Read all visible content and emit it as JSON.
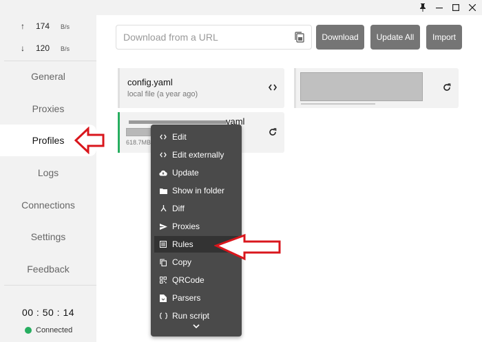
{
  "titlebar": {
    "pin_icon": "pin-icon",
    "minimize_icon": "minimize-icon",
    "maximize_icon": "maximize-icon",
    "close_icon": "close-icon"
  },
  "traffic": {
    "upload": {
      "arrow": "↑",
      "value": "174",
      "unit": "B/s"
    },
    "download": {
      "arrow": "↓",
      "value": "120",
      "unit": "B/s"
    }
  },
  "sidebar": {
    "items": [
      {
        "label": "General"
      },
      {
        "label": "Proxies"
      },
      {
        "label": "Profiles"
      },
      {
        "label": "Logs"
      },
      {
        "label": "Connections"
      },
      {
        "label": "Settings"
      },
      {
        "label": "Feedback"
      }
    ],
    "active": "Profiles",
    "timer": "00 : 50 : 14",
    "status": "Connected",
    "status_color": "#27ae60"
  },
  "toolbar": {
    "url_placeholder": "Download from a URL",
    "download_label": "Download",
    "update_all_label": "Update All",
    "import_label": "Import"
  },
  "profiles": [
    {
      "name": "config.yaml",
      "subtitle": "local file (a year ago)",
      "icon": "code-icon"
    },
    {
      "name": "",
      "subtitle": "",
      "icon": "refresh-icon"
    },
    {
      "name": "yaml",
      "subtitle": "618.7MB",
      "icon": "refresh-icon"
    }
  ],
  "context_menu": {
    "items": [
      {
        "label": "Edit",
        "icon": "code-icon"
      },
      {
        "label": "Edit externally",
        "icon": "code-icon"
      },
      {
        "label": "Update",
        "icon": "cloud-upload-icon"
      },
      {
        "label": "Show in folder",
        "icon": "folder-icon"
      },
      {
        "label": "Diff",
        "icon": "diff-icon"
      },
      {
        "label": "Proxies",
        "icon": "send-icon"
      },
      {
        "label": "Rules",
        "icon": "list-icon"
      },
      {
        "label": "Copy",
        "icon": "copy-icon"
      },
      {
        "label": "QRCode",
        "icon": "qrcode-icon"
      },
      {
        "label": "Parsers",
        "icon": "parsers-icon"
      },
      {
        "label": "Run script",
        "icon": "script-icon"
      }
    ],
    "highlighted": "Rules"
  },
  "colors": {
    "accent_green": "#27ae60",
    "button_gray": "#757575",
    "menu_bg": "#4a4a4a",
    "annotation_red": "#d9161c"
  }
}
